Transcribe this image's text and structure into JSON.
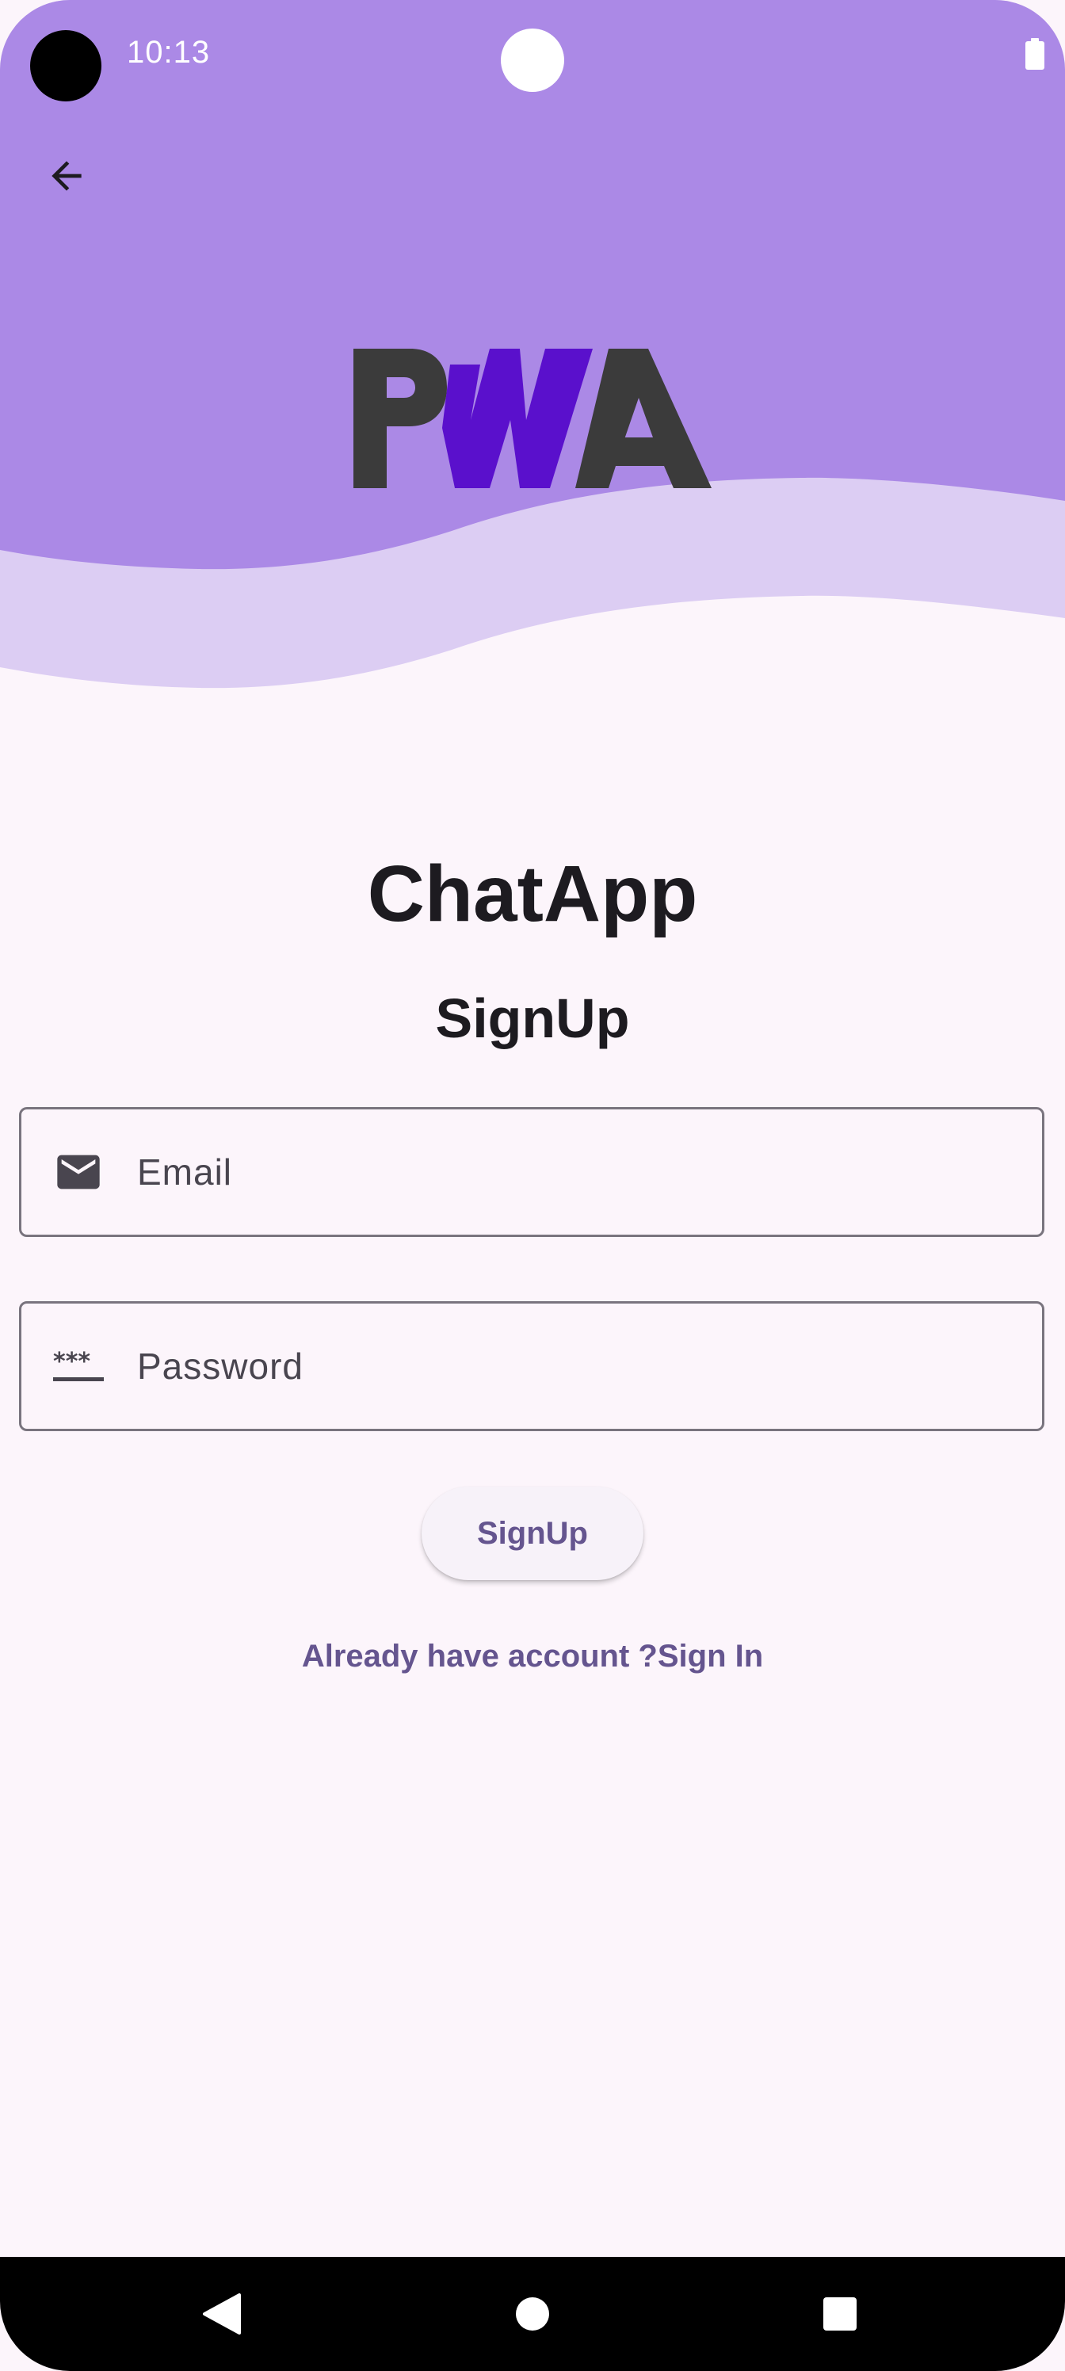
{
  "status_bar": {
    "time": "10:13",
    "battery_icon": "battery-full-icon"
  },
  "header": {
    "back_icon": "arrow-back-icon",
    "logo_text": "PWA",
    "colors": {
      "top_wave": "#ab89e6",
      "second_wave": "#dccdf3",
      "logo_dark": "#3b3b3b",
      "logo_purple": "#5a10cc"
    }
  },
  "main": {
    "app_title": "ChatApp",
    "form_title": "SignUp",
    "email_field": {
      "icon": "mail-icon",
      "placeholder": "Email",
      "value": ""
    },
    "password_field": {
      "icon": "password-icon",
      "placeholder": "Password",
      "value": ""
    },
    "signup_button_label": "SignUp",
    "signin_link": "Already have account ?Sign In"
  },
  "nav_bar": {
    "back_icon": "nav-back-icon",
    "home_icon": "nav-home-icon",
    "recents_icon": "nav-recents-icon"
  },
  "theme": {
    "background": "#fcf5fb",
    "primary": "#65558f",
    "text": "#1d1b20",
    "outline": "#79747e"
  }
}
